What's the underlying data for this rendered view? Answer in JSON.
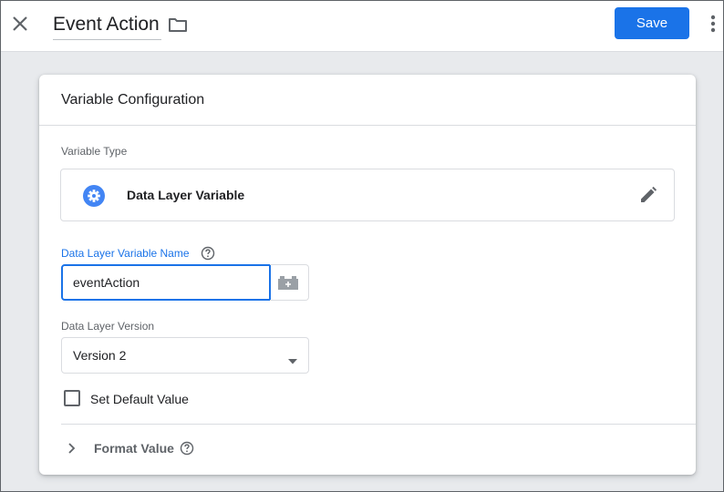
{
  "header": {
    "title": "Event Action",
    "save_label": "Save",
    "close_icon": "close-icon",
    "folder_icon": "folder-icon",
    "more_icon": "more-vert-icon",
    "accent_color": "#1a73e8"
  },
  "card": {
    "title": "Variable Configuration",
    "variable_type_label": "Variable Type",
    "variable_type_name": "Data Layer Variable",
    "variable_type_icon": "gear-icon",
    "edit_icon": "pencil-icon",
    "dl_name_label": "Data Layer Variable Name",
    "dl_name_value": "eventAction",
    "variable_picker_icon": "add-variable-icon",
    "dl_version_label": "Data Layer Version",
    "dl_version_value": "Version 2",
    "default_value_label": "Set Default Value",
    "default_value_checked": false,
    "format_value_label": "Format Value"
  }
}
